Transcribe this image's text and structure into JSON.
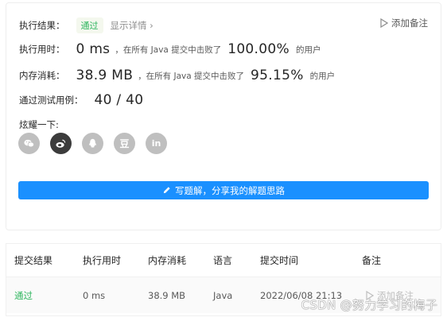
{
  "result": {
    "label": "执行结果：",
    "status": "通过",
    "detail_link": "显示详情 ›",
    "note_button": "添加备注"
  },
  "runtime": {
    "label": "执行用时：",
    "value": "0 ms",
    "mid_text": "，在所有 Java 提交中击败了",
    "percent": "100.00%",
    "suffix": "的用户"
  },
  "memory": {
    "label": "内存消耗：",
    "value": "38.9 MB",
    "mid_text": "，在所有 Java 提交中击败了",
    "percent": "95.15%",
    "suffix": "的用户"
  },
  "tests": {
    "label": "通过测试用例：",
    "value": "40 / 40"
  },
  "share": {
    "label": "炫耀一下:",
    "icons": [
      "wechat-icon",
      "weibo-icon",
      "qq-icon",
      "douban-icon",
      "linkedin-icon"
    ],
    "douban_glyph": "豆",
    "linkedin_glyph": "in",
    "button_label": "写题解，分享我的解题思路"
  },
  "table": {
    "headers": [
      "提交结果",
      "执行用时",
      "内存消耗",
      "语言",
      "提交时间",
      "备注"
    ],
    "rows": [
      {
        "status": "通过",
        "runtime": "0 ms",
        "memory": "38.9 MB",
        "language": "Java",
        "time": "2022/06/08 21:13",
        "note": "添加备注"
      }
    ]
  },
  "watermark": "CSDN @努力学习的梅子",
  "colors": {
    "accent": "#1a90ff",
    "success": "#2db55d",
    "icon_gray": "#bfbfbf",
    "icon_dark": "#3c3c3c"
  }
}
